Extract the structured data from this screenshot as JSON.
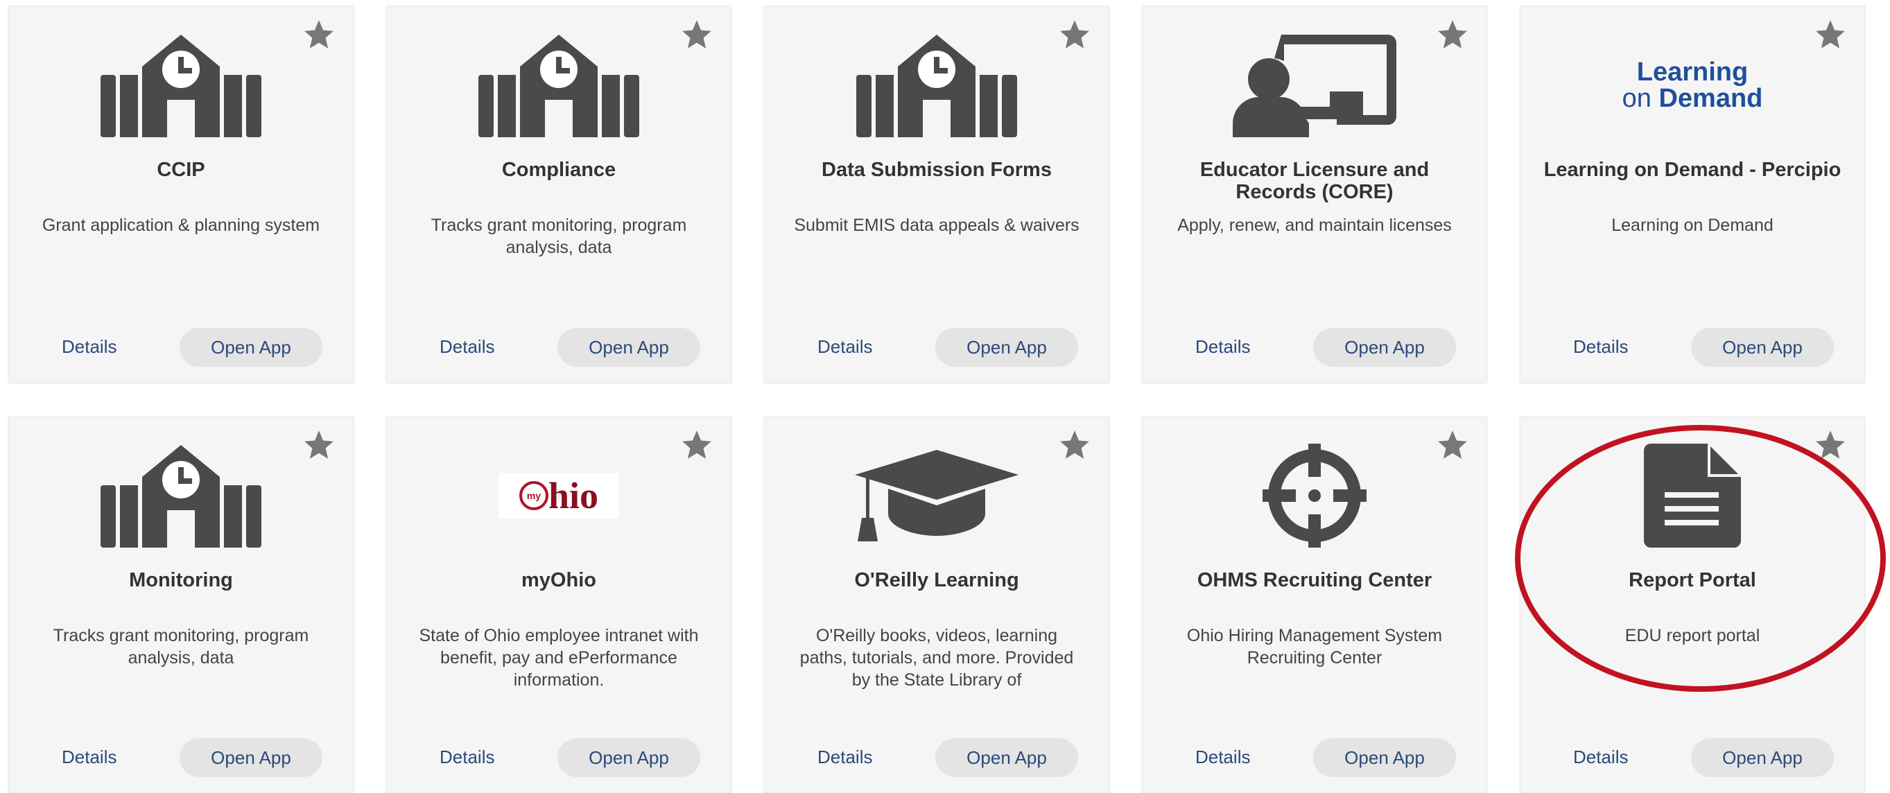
{
  "colors": {
    "card_bg": "#f5f5f5",
    "icon": "#4a4a4a",
    "link": "#2b4a7a",
    "button_bg": "#e4e4e4",
    "star": "#777777",
    "annotation": "#c1121f",
    "lod_blue": "#1f4e9c",
    "ohio_red": "#b3102a"
  },
  "cards": [
    {
      "title": "CCIP",
      "description": "Grant application & planning system",
      "icon": "school-icon",
      "details_label": "Details",
      "open_label": "Open App"
    },
    {
      "title": "Compliance",
      "description": "Tracks grant monitoring, program analysis, data",
      "icon": "school-icon",
      "details_label": "Details",
      "open_label": "Open App"
    },
    {
      "title": "Data Submission Forms",
      "description": "Submit EMIS data appeals & waivers",
      "icon": "school-icon",
      "details_label": "Details",
      "open_label": "Open App"
    },
    {
      "title": "Educator Licensure and Records (CORE)",
      "description": "Apply, renew, and maintain licenses",
      "icon": "teacher-board-icon",
      "details_label": "Details",
      "open_label": "Open App"
    },
    {
      "title": "Learning on Demand - Percipio",
      "description": "Learning on Demand",
      "icon": "learning-on-demand-logo",
      "logo_line1": "Learning",
      "logo_line2_a": "on ",
      "logo_line2_b": "Demand",
      "details_label": "Details",
      "open_label": "Open App"
    },
    {
      "title": "Monitoring",
      "description": "Tracks grant monitoring, program analysis, data",
      "icon": "school-icon",
      "details_label": "Details",
      "open_label": "Open App"
    },
    {
      "title": "myOhio",
      "description": "State of Ohio employee intranet with benefit, pay and ePerformance information.",
      "icon": "myohio-logo",
      "logo_small": "my",
      "logo_main": "hio",
      "details_label": "Details",
      "open_label": "Open App"
    },
    {
      "title": "O'Reilly Learning",
      "description": "O'Reilly books, videos, learning paths, tutorials, and more. Provided by the State Library of",
      "icon": "graduation-cap-icon",
      "details_label": "Details",
      "open_label": "Open App"
    },
    {
      "title": "OHMS Recruiting Center",
      "description": "Ohio Hiring Management System Recruiting Center",
      "icon": "crosshairs-icon",
      "details_label": "Details",
      "open_label": "Open App"
    },
    {
      "title": "Report Portal",
      "description": "EDU report portal",
      "icon": "document-icon",
      "details_label": "Details",
      "open_label": "Open App"
    }
  ]
}
